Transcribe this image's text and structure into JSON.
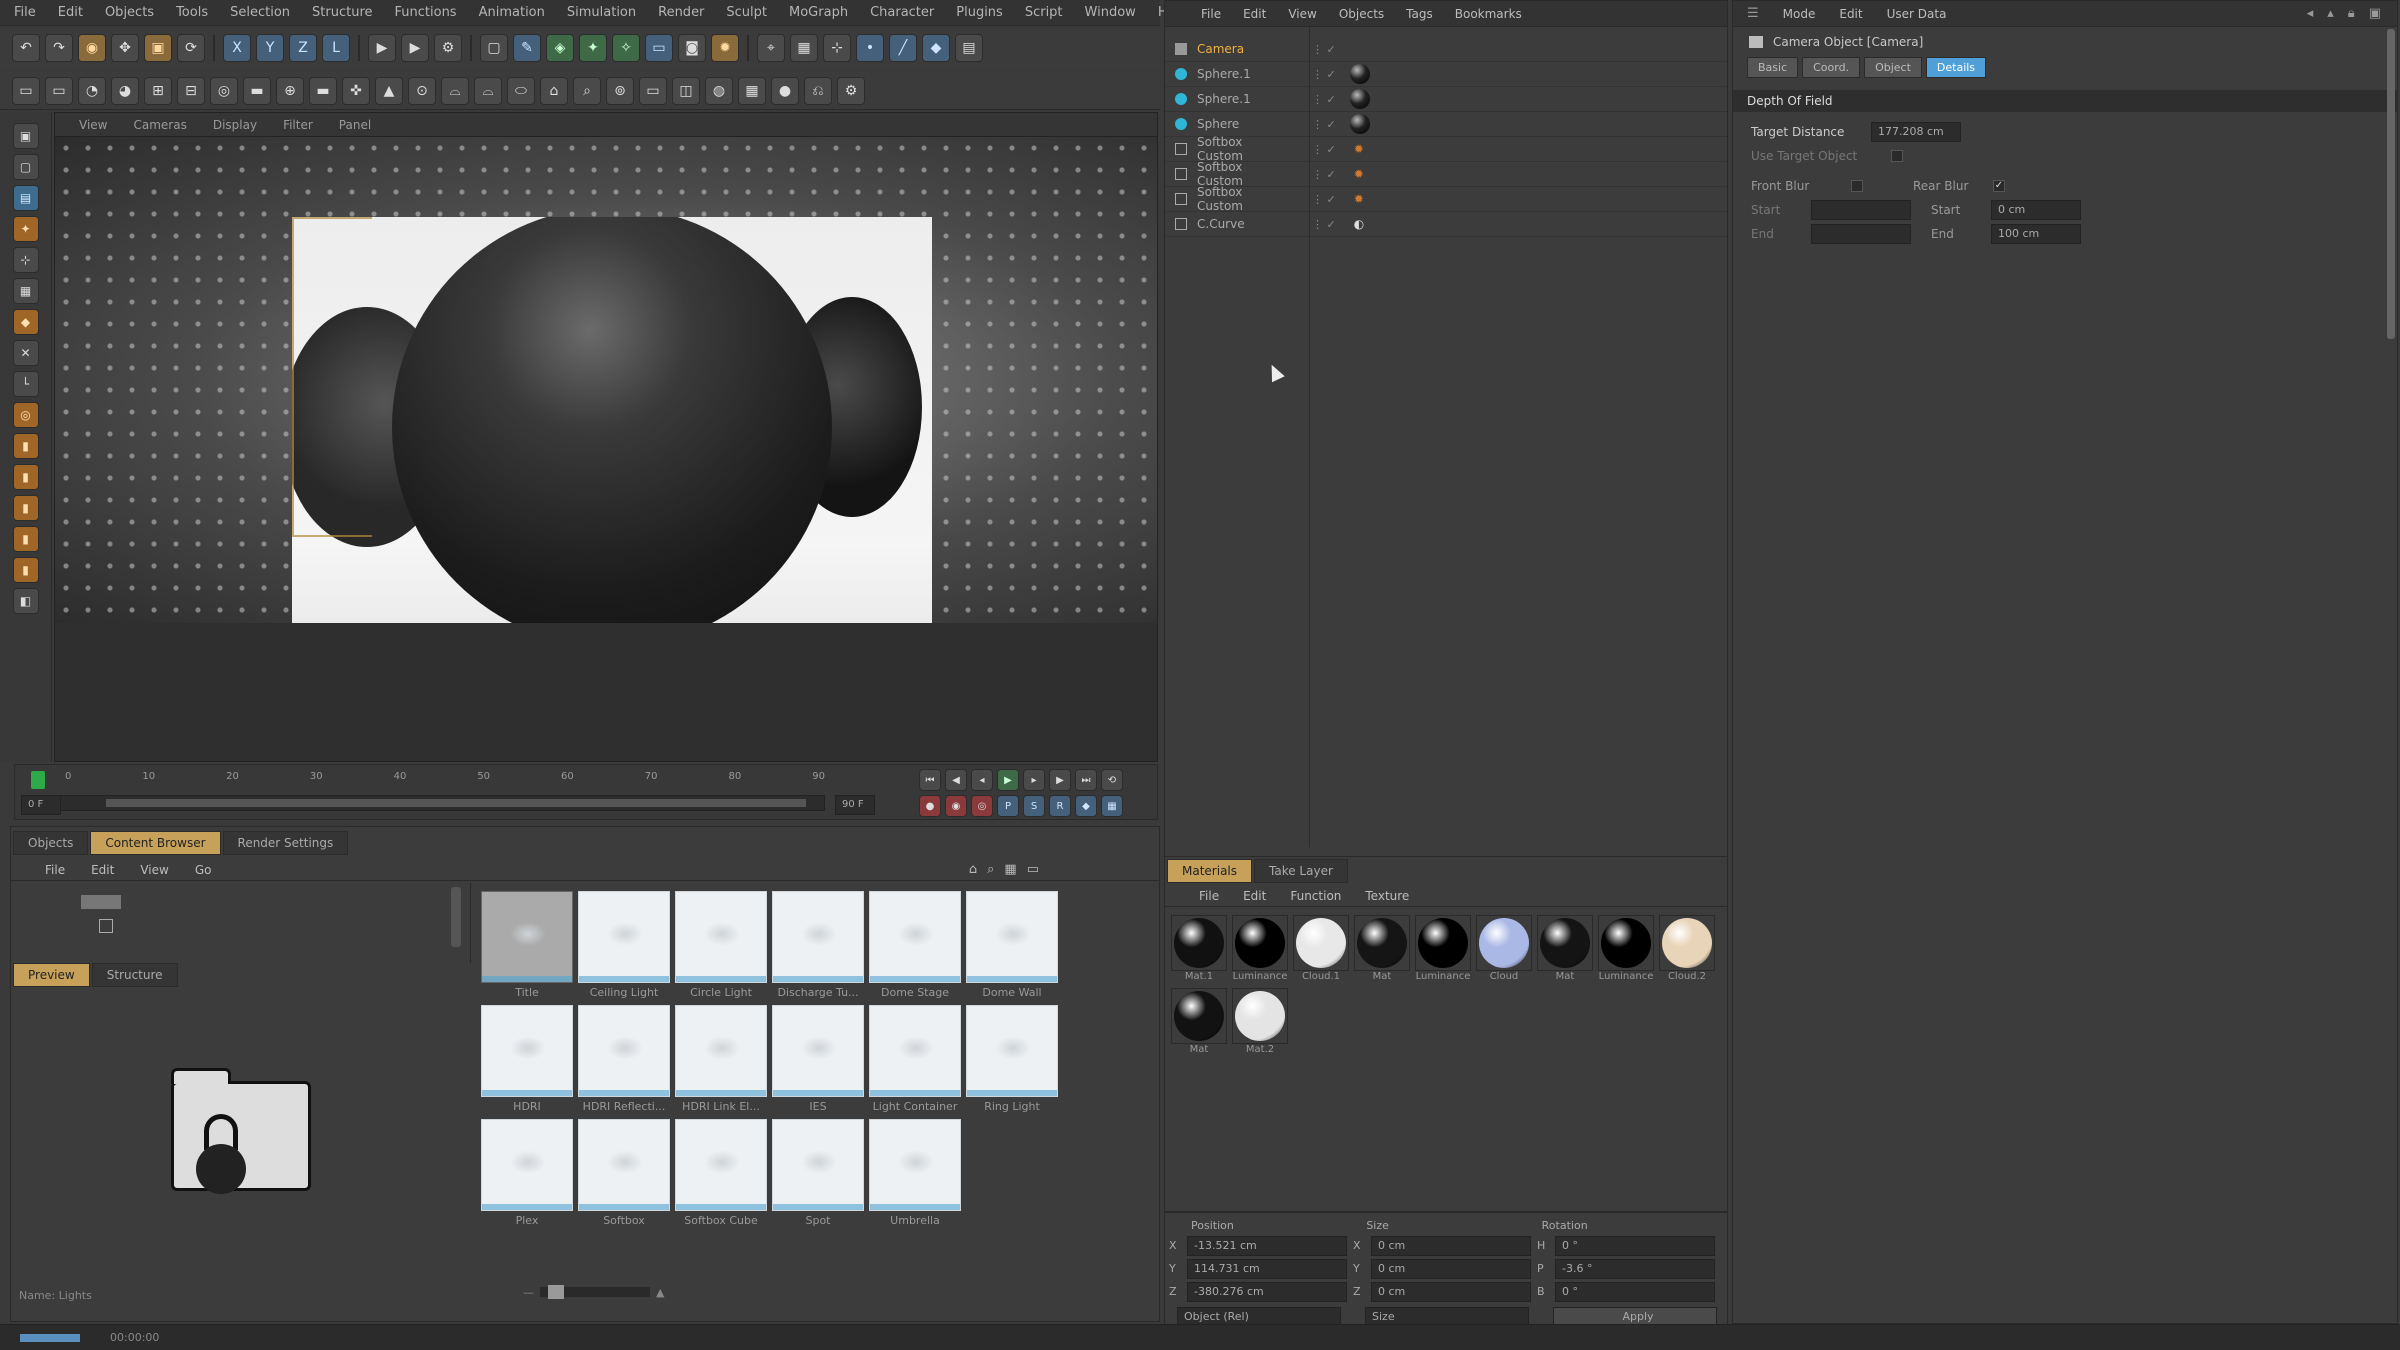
{
  "app": {
    "main_menu": [
      "File",
      "Edit",
      "Objects",
      "Tools",
      "Selection",
      "Structure",
      "Functions",
      "Animation",
      "Simulation",
      "Render",
      "Sculpt",
      "MoGraph",
      "Character",
      "Plugins",
      "Script",
      "Window",
      "Help"
    ]
  },
  "viewport": {
    "menu": [
      "View",
      "Cameras",
      "Display",
      "Filter",
      "Panel"
    ],
    "timeline": {
      "start": "0 F",
      "end": "90 F",
      "ticks": [
        "0",
        "10",
        "20",
        "30",
        "40",
        "50",
        "60",
        "70",
        "80",
        "90"
      ]
    }
  },
  "object_manager": {
    "menu": [
      "File",
      "Edit",
      "View",
      "Objects",
      "Tags",
      "Bookmarks"
    ],
    "objects": [
      {
        "name": "Camera",
        "icon": "camera-icon",
        "active": true
      },
      {
        "name": "Sphere.1",
        "icon": "sphere-icon"
      },
      {
        "name": "Sphere.1",
        "icon": "sphere-icon"
      },
      {
        "name": "Sphere",
        "icon": "sphere-icon"
      },
      {
        "name": "Softbox Custom",
        "icon": "light-icon"
      },
      {
        "name": "Softbox Custom",
        "icon": "light-icon"
      },
      {
        "name": "Softbox Custom",
        "icon": "light-icon"
      },
      {
        "name": "C.Curve",
        "icon": "curve-icon"
      }
    ]
  },
  "attribute_manager": {
    "menu": [
      "Mode",
      "Edit",
      "User Data"
    ],
    "title": "Camera Object [Camera]",
    "tabs": [
      "Basic",
      "Coord.",
      "Object",
      "Details"
    ],
    "active_tab": "Details",
    "section": "Depth Of Field",
    "target_distance_label": "Target Distance",
    "target_distance_value": "177.208 cm",
    "use_target_label": "Use Target Object",
    "front_blur_label": "Front Blur",
    "rear_blur_label": "Rear Blur",
    "start_label": "Start",
    "end_label": "End",
    "start_value": "0 cm",
    "end_value": "100 cm"
  },
  "content_browser": {
    "tabs": [
      "Objects",
      "Content Browser",
      "Render Settings"
    ],
    "menu": [
      "File",
      "Edit",
      "View",
      "Go"
    ],
    "subtabs": [
      "Preview",
      "Structure"
    ],
    "items": [
      {
        "label": "Title"
      },
      {
        "label": "Ceiling Light"
      },
      {
        "label": "Circle Light"
      },
      {
        "label": "Discharge Tu..."
      },
      {
        "label": "Dome Stage"
      },
      {
        "label": "Dome Wall"
      },
      {
        "label": "HDRI"
      },
      {
        "label": "HDRI Reflecti..."
      },
      {
        "label": "HDRI Link El..."
      },
      {
        "label": "IES"
      },
      {
        "label": "Light Container"
      },
      {
        "label": "Ring Light"
      },
      {
        "label": "Plex"
      },
      {
        "label": "Softbox"
      },
      {
        "label": "Softbox Cube"
      },
      {
        "label": "Spot"
      },
      {
        "label": "Umbrella"
      }
    ],
    "status": "Name: Lights"
  },
  "material_manager": {
    "tabs": [
      "Materials",
      "Take Layer"
    ],
    "menu": [
      "File",
      "Edit",
      "Function",
      "Texture"
    ],
    "materials": [
      {
        "label": "Mat.1",
        "color": "#111111"
      },
      {
        "label": "Luminance",
        "color": "#000000"
      },
      {
        "label": "Cloud.1",
        "color": "#e8e8e8"
      },
      {
        "label": "Mat",
        "color": "#151515"
      },
      {
        "label": "Luminance",
        "color": "#000000"
      },
      {
        "label": "Cloud",
        "color": "#aab8e6"
      },
      {
        "label": "Mat",
        "color": "#141414"
      },
      {
        "label": "Luminance",
        "color": "#000000"
      },
      {
        "label": "Cloud.2",
        "color": "#e8d4b8"
      },
      {
        "label": "Mat",
        "color": "#121212"
      },
      {
        "label": "Mat.2",
        "color": "#e4e4e4"
      }
    ]
  },
  "coordinates": {
    "headers": [
      "Position",
      "Size",
      "Rotation"
    ],
    "rows": [
      {
        "axis": "X",
        "pos": "-13.521 cm",
        "size": "0 cm",
        "rot_axis": "H",
        "rot": "0 °"
      },
      {
        "axis": "Y",
        "pos": "114.731 cm",
        "size": "0 cm",
        "rot_axis": "P",
        "rot": "-3.6 °"
      },
      {
        "axis": "Z",
        "pos": "-380.276 cm",
        "size": "0 cm",
        "rot_axis": "B",
        "rot": "0 °"
      }
    ],
    "mode": "Object (Rel)",
    "size_mode": "Size",
    "apply": "Apply"
  },
  "statusbar": {
    "time": "00:00:00"
  }
}
